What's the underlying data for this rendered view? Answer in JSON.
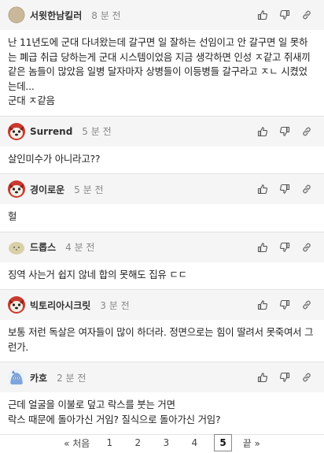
{
  "comments": [
    {
      "user": "서윗한남킬러",
      "time": "8 분 전",
      "avatar": "tan-circle",
      "lines": [
        "난 11년도에 군대 다녀왔는데 갈구면 일 잘하는 선임이고 안 갈구면 일 못하는 폐급 취급 당하는게 군대 시스템이었음 지금 생각하면 인성 ㅈ같고 쥐새끼 같은 놈들이 많았음 일병 달자마자 상병들이 이등병들 갈구라고 ㅈㄴ 시켰었는데...",
        "군대 ㅈ같음"
      ]
    },
    {
      "user": "Surrend",
      "time": "5 분 전",
      "avatar": "red-dog",
      "lines": [
        "살인미수가 아니라고??"
      ]
    },
    {
      "user": "경이로운",
      "time": "5 분 전",
      "avatar": "red-dog",
      "lines": [
        "헐"
      ]
    },
    {
      "user": "드롭스",
      "time": "4 분 전",
      "avatar": "pebble",
      "lines": [
        "징역 사는거 쉽지 않네 합의 못해도 집유 ㄷㄷ"
      ]
    },
    {
      "user": "빅토리아시크릿",
      "time": "3 분 전",
      "avatar": "red-dog",
      "lines": [
        "보통 저런 독살은 여자들이 많이 하더라. 정면으로는 힘이 딸려서 못죽여서 그런가."
      ]
    },
    {
      "user": "카호",
      "time": "2 분 전",
      "avatar": "blue-creature",
      "lines": [
        "근데 얼굴을 이불로 덮고 락스를 붓는 거면",
        "락스 때문에 돌아가신 거임? 질식으로 돌아가신 거임?"
      ]
    }
  ],
  "icons": {
    "like": "thumbs-up-icon",
    "dislike": "thumbs-down-icon",
    "link": "link-icon"
  },
  "pager": {
    "first": "« 처음",
    "pages": [
      "1",
      "2",
      "3",
      "4",
      "5"
    ],
    "current": "5",
    "last": "끝 »"
  }
}
